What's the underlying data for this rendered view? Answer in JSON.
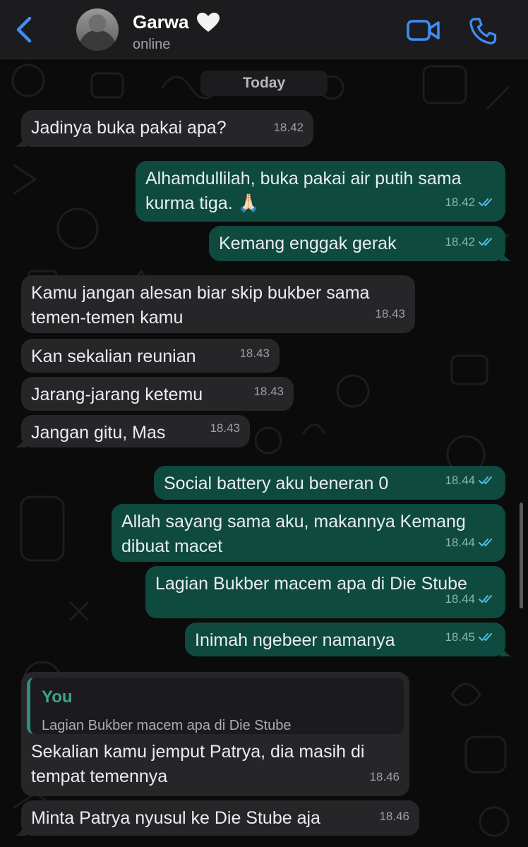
{
  "header": {
    "contact_name": "Garwa",
    "status": "online",
    "accent": "#3e8ef7"
  },
  "chat": {
    "date_label": "Today",
    "messages": [
      {
        "dir": "in",
        "text": "Jadinya buka pakai apa?",
        "time": "18.42"
      },
      {
        "dir": "out",
        "text": "Alhamdullilah, buka pakai air putih sama kurma tiga. 🙏🏻",
        "time": "18.42",
        "ticks": "read"
      },
      {
        "dir": "out",
        "text": "Kemang enggak gerak",
        "time": "18.42",
        "ticks": "read"
      },
      {
        "dir": "in",
        "text": "Kamu jangan alesan biar skip bukber sama temen-temen kamu",
        "time": "18.43"
      },
      {
        "dir": "in",
        "text": "Kan sekalian reunian",
        "time": "18.43"
      },
      {
        "dir": "in",
        "text": "Jarang-jarang ketemu",
        "time": "18.43"
      },
      {
        "dir": "in",
        "text": "Jangan gitu, Mas",
        "time": "18.43"
      },
      {
        "dir": "out",
        "text": "Social battery aku beneran 0",
        "time": "18.44",
        "ticks": "read"
      },
      {
        "dir": "out",
        "text": "Allah sayang sama aku, makannya Kemang dibuat macet",
        "time": "18.44",
        "ticks": "read"
      },
      {
        "dir": "out",
        "text": "Lagian Bukber macem apa di Die Stube",
        "time": "18.44",
        "ticks": "read"
      },
      {
        "dir": "out",
        "text": "Inimah ngebeer namanya",
        "time": "18.45",
        "ticks": "read"
      },
      {
        "dir": "in",
        "quote": {
          "author": "You",
          "text": "Lagian Bukber macem apa di Die Stube"
        },
        "text": "Sekalian kamu jemput Patrya, dia masih di tempat temennya",
        "time": "18.46"
      },
      {
        "dir": "in",
        "text": "Minta Patrya nyusul ke Die Stube aja",
        "time": "18.46"
      }
    ]
  },
  "colors": {
    "incoming_bubble": "#262628",
    "outgoing_bubble": "#0f4a3e",
    "read_ticks": "#53bdeb"
  }
}
